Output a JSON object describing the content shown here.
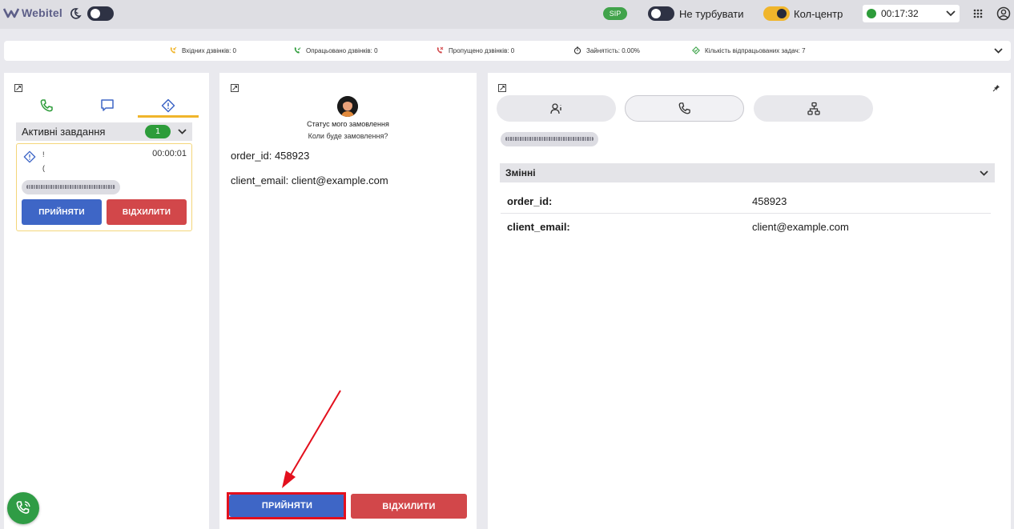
{
  "app": {
    "logo_text": "Webitel",
    "sip_label": "SIP",
    "dnd_label": "Не турбувати",
    "callcenter_label": "Кол-центр",
    "status_timer": "00:17:32",
    "status_color": "#2d9c3a"
  },
  "stats": [
    {
      "icon": "incoming-call-icon",
      "label": "Вхідних дзвінків: 0"
    },
    {
      "icon": "handled-call-icon",
      "label": "Опрацьовано дзвінків: 0"
    },
    {
      "icon": "missed-call-icon",
      "label": "Пропущено дзвінків: 0"
    },
    {
      "icon": "timer-icon",
      "label": "Зайнятість: 0.00%"
    },
    {
      "icon": "task-done-icon",
      "label": "Кількість відпрацьованих задач: 7"
    }
  ],
  "left_panel": {
    "tabs": [
      "phone-tab",
      "chat-tab",
      "task-tab"
    ],
    "active_tab": "task-tab",
    "section_title": "Активні завдання",
    "active_count": "1",
    "task": {
      "line1": "!",
      "line2": "(",
      "timer": "00:00:01"
    },
    "accept_label": "ПРИЙНЯТИ",
    "decline_label": "ВІДХИЛИТИ"
  },
  "middle_panel": {
    "title": "Статус мого замовлення",
    "subtitle": "Коли буде замовлення?",
    "fields": [
      {
        "key": "order_id:",
        "value": "458923"
      },
      {
        "key": "client_email:",
        "value": "client@example.com"
      }
    ],
    "accept_label": "ПРИЙНЯТИ",
    "decline_label": "ВІДХИЛИТИ"
  },
  "right_panel": {
    "tabs": [
      "contact-info-tab",
      "call-tab",
      "flow-tab"
    ],
    "active_tab": "call-tab",
    "variables_title": "Змінні",
    "variables": [
      {
        "key": "order_id:",
        "value": "458923"
      },
      {
        "key": "client_email:",
        "value": "client@example.com"
      }
    ]
  },
  "colors": {
    "accent_green": "#2d9c3a",
    "accept_blue": "#3e66c6",
    "decline_red": "#d2474a",
    "highlight_red": "#e3101d",
    "tab_underline": "#f0b52b"
  }
}
